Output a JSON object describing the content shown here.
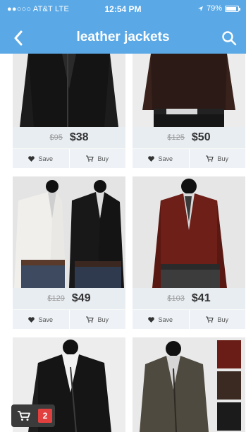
{
  "status_bar": {
    "carrier": "●●○○○ AT&T  LTE",
    "time": "12:54 PM",
    "battery": "79%"
  },
  "nav": {
    "title": "leather jackets",
    "back_icon": "chevron-left-icon",
    "search_icon": "search-icon"
  },
  "products": [
    {
      "old_price": "$95",
      "price": "$38",
      "save_label": "Save",
      "buy_label": "Buy"
    },
    {
      "old_price": "$125",
      "price": "$50",
      "save_label": "Save",
      "buy_label": "Buy"
    },
    {
      "old_price": "$129",
      "price": "$49",
      "save_label": "Save",
      "buy_label": "Buy"
    },
    {
      "old_price": "$103",
      "price": "$41",
      "save_label": "Save",
      "buy_label": "Buy"
    },
    {
      "old_price": "",
      "price": "",
      "save_label": "",
      "buy_label": ""
    },
    {
      "old_price": "",
      "price": "",
      "save_label": "",
      "buy_label": ""
    }
  ],
  "cart": {
    "count": "2"
  },
  "colors": {
    "header": "#5aa9e6",
    "card_bar": "#e8edf2",
    "badge": "#e2403f"
  }
}
